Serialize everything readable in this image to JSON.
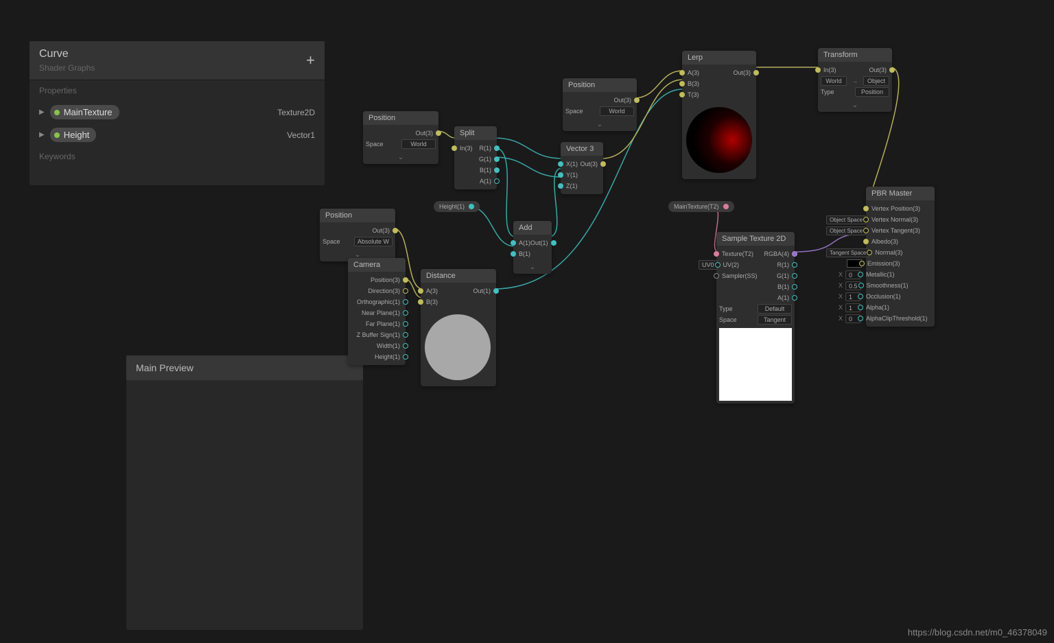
{
  "blackboard": {
    "title": "Curve",
    "subtitle": "Shader Graphs",
    "section_props": "Properties",
    "section_keywords": "Keywords",
    "props": [
      {
        "name": "MainTexture",
        "type": "Texture2D"
      },
      {
        "name": "Height",
        "type": "Vector1"
      }
    ]
  },
  "preview": {
    "title": "Main Preview"
  },
  "nodes": {
    "pos1": {
      "title": "Position",
      "out": "Out(3)",
      "space_l": "Space",
      "space_v": "World"
    },
    "pos2": {
      "title": "Position",
      "out": "Out(3)",
      "space_l": "Space",
      "space_v": "Absolute W"
    },
    "pos3": {
      "title": "Position",
      "out": "Out(3)",
      "space_l": "Space",
      "space_v": "World"
    },
    "split": {
      "title": "Split",
      "in": "In(3)",
      "r": "R(1)",
      "g": "G(1)",
      "b": "B(1)",
      "a": "A(1)"
    },
    "vec3": {
      "title": "Vector 3",
      "x": "X(1)",
      "y": "Y(1)",
      "z": "Z(1)",
      "out": "Out(3)"
    },
    "height": {
      "label": "Height(1)"
    },
    "maintex": {
      "label": "MainTexture(T2)"
    },
    "add": {
      "title": "Add",
      "a": "A(1)",
      "b": "B(1)",
      "out": "Out(1)"
    },
    "camera": {
      "title": "Camera",
      "rows": [
        "Position(3)",
        "Direction(3)",
        "Orthographic(1)",
        "Near Plane(1)",
        "Far Plane(1)",
        "Z Buffer Sign(1)",
        "Width(1)",
        "Height(1)"
      ]
    },
    "distance": {
      "title": "Distance",
      "a": "A(3)",
      "b": "B(3)",
      "out": "Out(1)"
    },
    "lerp": {
      "title": "Lerp",
      "a": "A(3)",
      "b": "B(3)",
      "t": "T(3)",
      "out": "Out(3)"
    },
    "transform": {
      "title": "Transform",
      "in": "In(3)",
      "out": "Out(3)",
      "from": "World",
      "to": "Object",
      "type_l": "Type",
      "type_v": "Position"
    },
    "sample": {
      "title": "Sample Texture 2D",
      "tex": "Texture(T2)",
      "uv": "UV(2)",
      "ss": "Sampler(SS)",
      "uv0": "UV0",
      "rgba": "RGBA(4)",
      "r": "R(1)",
      "g": "G(1)",
      "b": "B(1)",
      "a": "A(1)",
      "type_l": "Type",
      "type_v": "Default",
      "space_l": "Space",
      "space_v": "Tangent"
    },
    "pbr": {
      "title": "PBR Master",
      "vp": "Vertex Position(3)",
      "vn": "Vertex Normal(3)",
      "vt": "Vertex Tangent(3)",
      "albedo": "Albedo(3)",
      "normal": "Normal(3)",
      "emission": "Emission(3)",
      "metallic": "Metallic(1)",
      "smooth": "Smoothness(1)",
      "occ": "Occlusion(1)",
      "alpha": "Alpha(1)",
      "clip": "AlphaClipThreshold(1)",
      "os": "Object Space",
      "ts": "Tangent Space",
      "x": "X",
      "v0": "0",
      "v05": "0.5",
      "v1": "1"
    }
  },
  "watermark": "https://blog.csdn.net/m0_46378049"
}
